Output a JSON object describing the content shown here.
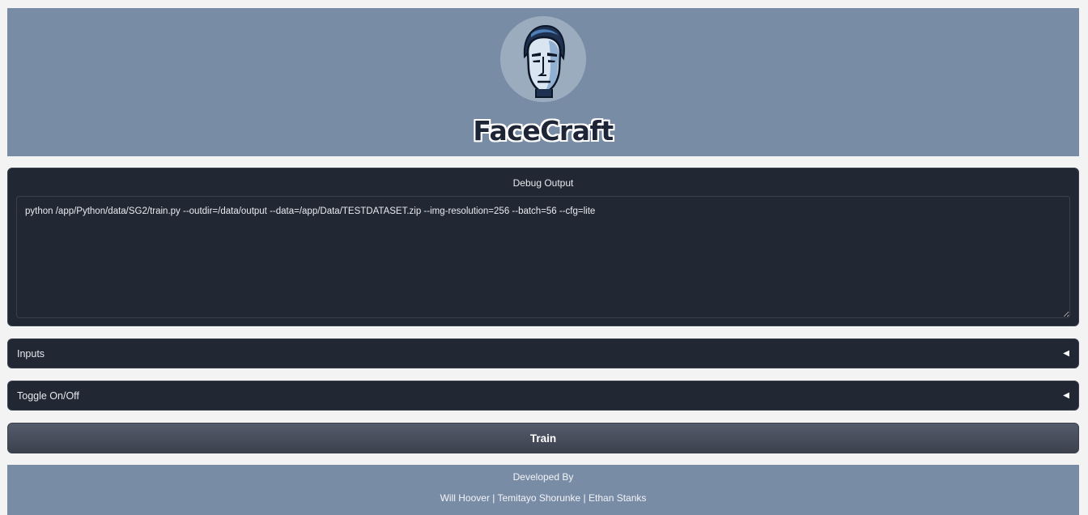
{
  "header": {
    "app_title": "FaceCraft",
    "logo_icon": "face-portrait-icon"
  },
  "debug": {
    "label": "Debug Output",
    "value": "python /app/Python/data/SG2/train.py --outdir=/data/output --data=/app/Data/TESTDATASET.zip --img-resolution=256 --batch=56 --cfg=lite"
  },
  "accordions": [
    {
      "label": "Inputs",
      "arrow": "◀"
    },
    {
      "label": "Toggle On/Off",
      "arrow": "◀"
    }
  ],
  "train_button": {
    "label": "Train"
  },
  "footer": {
    "title": "Developed By",
    "names": "Will Hoover | Temitayo Shorunke | Ethan Stanks"
  },
  "colors": {
    "header_bg": "#798ca6",
    "panel_bg": "#222734",
    "page_bg": "#f3f3f3"
  }
}
